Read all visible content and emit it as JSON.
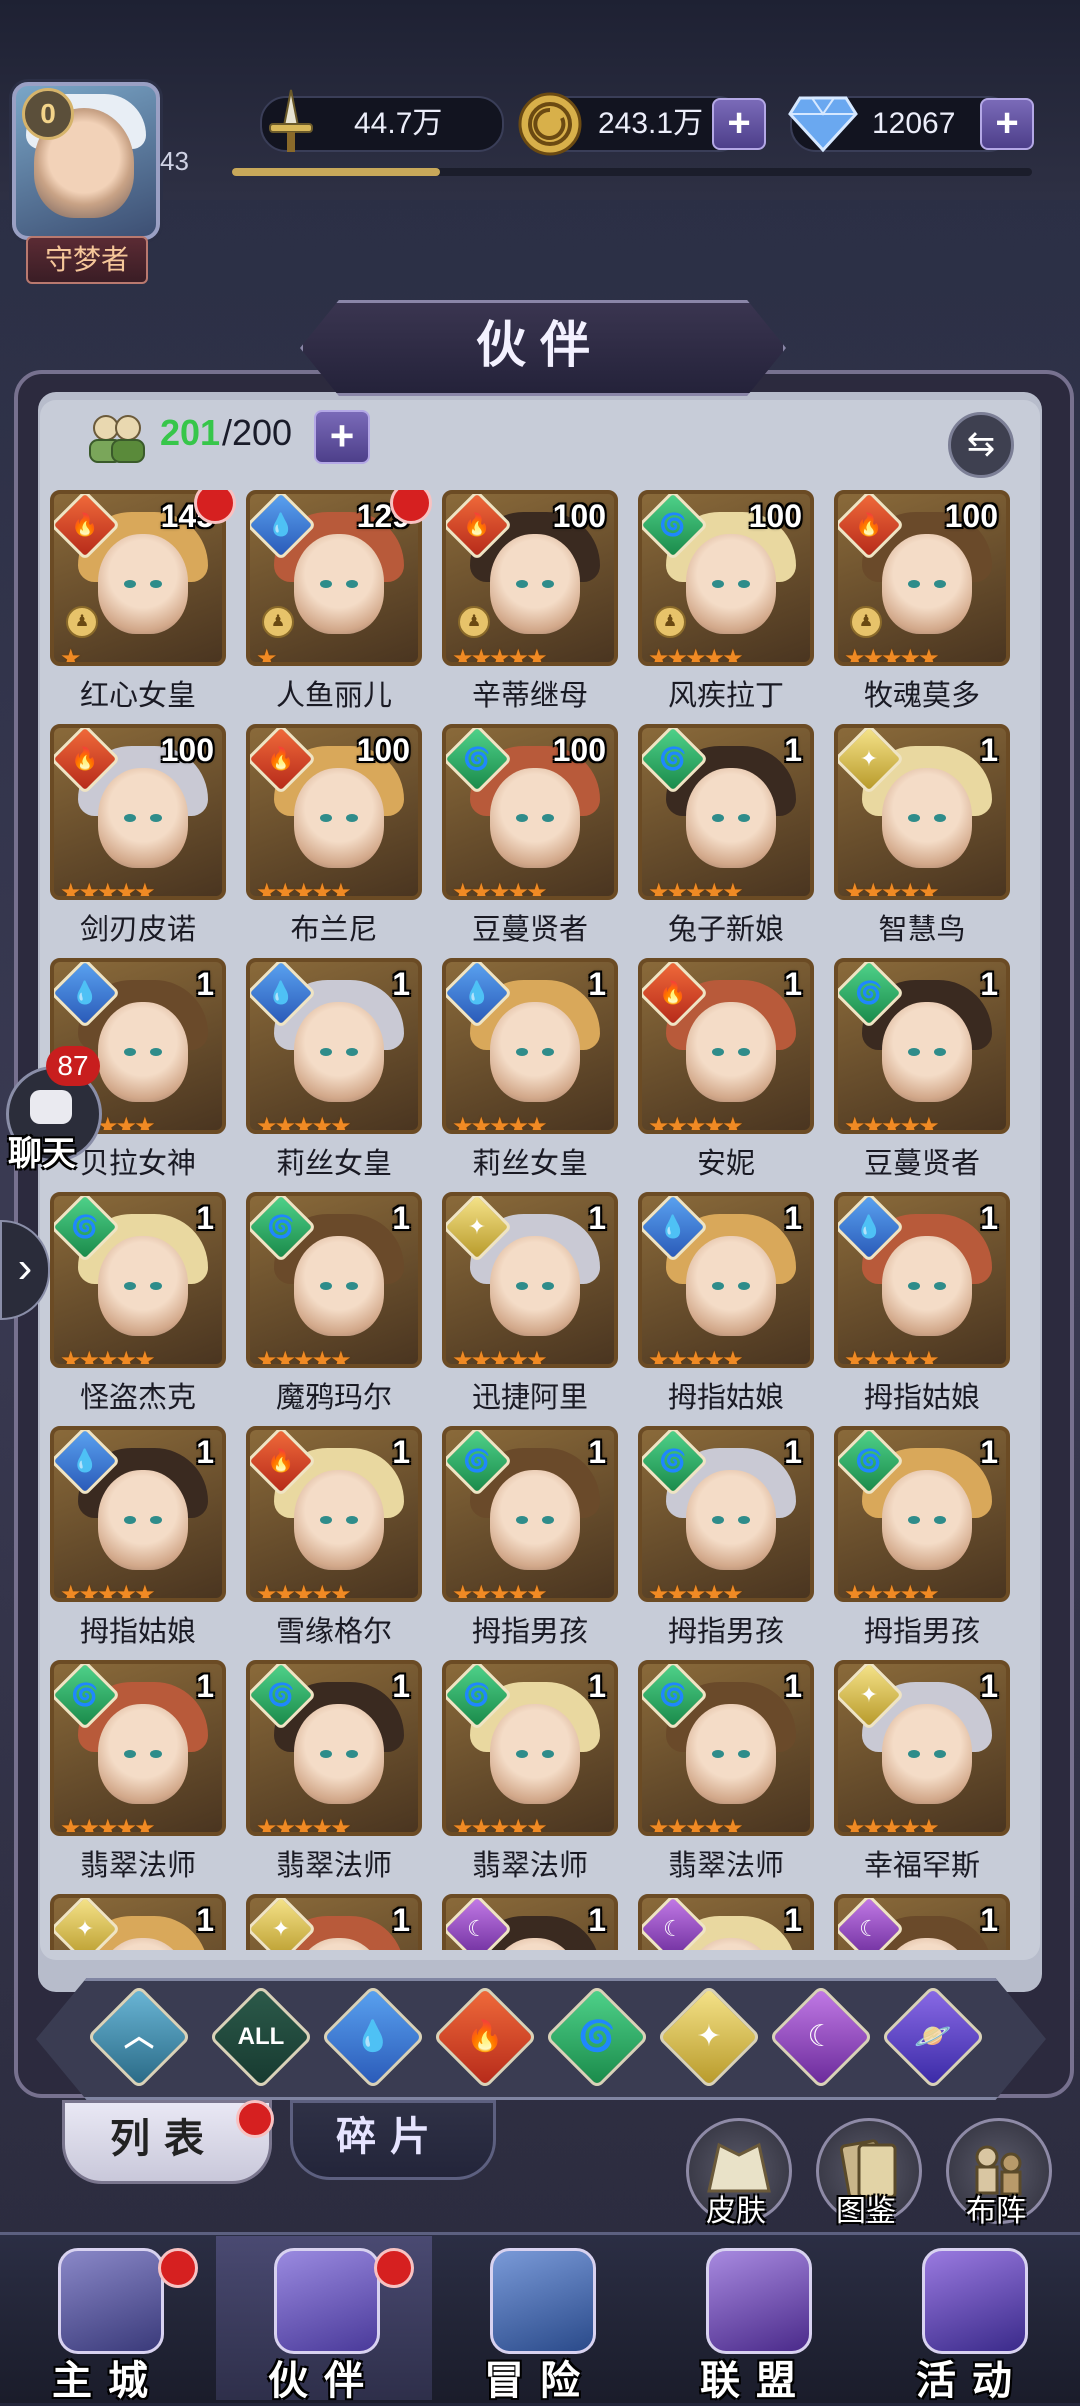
{
  "player": {
    "avatar_level": "0",
    "title": "守梦者",
    "level": "43",
    "exp_fraction": 0.26
  },
  "resources": {
    "power": "44.7万",
    "gold": "243.1万",
    "gems": "12067",
    "plus": "+"
  },
  "page": {
    "title": "伙伴"
  },
  "roster": {
    "current": "201",
    "max": "/200",
    "plus": "+",
    "sort_icon": "⇆"
  },
  "elements": {
    "fire": {
      "glyph": "🔥",
      "color": "#d8452a"
    },
    "water": {
      "glyph": "💧",
      "color": "#3a7ad6"
    },
    "wind": {
      "glyph": "🌀",
      "color": "#2aa864"
    },
    "light": {
      "glyph": "✦",
      "color": "#d4b84a"
    },
    "dark": {
      "glyph": "☾",
      "color": "#9a4ad0"
    }
  },
  "heroes": [
    {
      "name": "红心女皇",
      "level": "145",
      "element": "fire",
      "stars": 1,
      "rank": true,
      "dot": true
    },
    {
      "name": "人鱼丽儿",
      "level": "129",
      "element": "water",
      "stars": 1,
      "rank": true,
      "dot": true
    },
    {
      "name": "辛蒂继母",
      "level": "100",
      "element": "fire",
      "stars": 5,
      "rank": true,
      "dot": false
    },
    {
      "name": "风疾拉丁",
      "level": "100",
      "element": "wind",
      "stars": 5,
      "rank": true,
      "dot": false
    },
    {
      "name": "牧魂莫多",
      "level": "100",
      "element": "fire",
      "stars": 5,
      "rank": true,
      "dot": false
    },
    {
      "name": "剑刃皮诺",
      "level": "100",
      "element": "fire",
      "stars": 5,
      "rank": false,
      "dot": false
    },
    {
      "name": "布兰尼",
      "level": "100",
      "element": "fire",
      "stars": 5,
      "rank": false,
      "dot": false
    },
    {
      "name": "豆蔓贤者",
      "level": "100",
      "element": "wind",
      "stars": 5,
      "rank": false,
      "dot": false
    },
    {
      "name": "兔子新娘",
      "level": "1",
      "element": "wind",
      "stars": 5,
      "rank": false,
      "dot": false
    },
    {
      "name": "智慧鸟",
      "level": "1",
      "element": "light",
      "stars": 5,
      "rank": false,
      "dot": false
    },
    {
      "name": "贝拉女神",
      "level": "1",
      "element": "water",
      "stars": 5,
      "rank": false,
      "dot": false
    },
    {
      "name": "莉丝女皇",
      "level": "1",
      "element": "water",
      "stars": 5,
      "rank": false,
      "dot": false
    },
    {
      "name": "莉丝女皇",
      "level": "1",
      "element": "water",
      "stars": 5,
      "rank": false,
      "dot": false
    },
    {
      "name": "安妮",
      "level": "1",
      "element": "fire",
      "stars": 5,
      "rank": false,
      "dot": false
    },
    {
      "name": "豆蔓贤者",
      "level": "1",
      "element": "wind",
      "stars": 5,
      "rank": false,
      "dot": false
    },
    {
      "name": "怪盗杰克",
      "level": "1",
      "element": "wind",
      "stars": 5,
      "rank": false,
      "dot": false
    },
    {
      "name": "魔鸦玛尔",
      "level": "1",
      "element": "wind",
      "stars": 5,
      "rank": false,
      "dot": false
    },
    {
      "name": "迅捷阿里",
      "level": "1",
      "element": "light",
      "stars": 5,
      "rank": false,
      "dot": false
    },
    {
      "name": "拇指姑娘",
      "level": "1",
      "element": "water",
      "stars": 5,
      "rank": false,
      "dot": false
    },
    {
      "name": "拇指姑娘",
      "level": "1",
      "element": "water",
      "stars": 5,
      "rank": false,
      "dot": false
    },
    {
      "name": "拇指姑娘",
      "level": "1",
      "element": "water",
      "stars": 5,
      "rank": false,
      "dot": false
    },
    {
      "name": "雪缘格尔",
      "level": "1",
      "element": "fire",
      "stars": 5,
      "rank": false,
      "dot": false
    },
    {
      "name": "拇指男孩",
      "level": "1",
      "element": "wind",
      "stars": 5,
      "rank": false,
      "dot": false
    },
    {
      "name": "拇指男孩",
      "level": "1",
      "element": "wind",
      "stars": 5,
      "rank": false,
      "dot": false
    },
    {
      "name": "拇指男孩",
      "level": "1",
      "element": "wind",
      "stars": 5,
      "rank": false,
      "dot": false
    },
    {
      "name": "翡翠法师",
      "level": "1",
      "element": "wind",
      "stars": 5,
      "rank": false,
      "dot": false
    },
    {
      "name": "翡翠法师",
      "level": "1",
      "element": "wind",
      "stars": 5,
      "rank": false,
      "dot": false
    },
    {
      "name": "翡翠法师",
      "level": "1",
      "element": "wind",
      "stars": 5,
      "rank": false,
      "dot": false
    },
    {
      "name": "翡翠法师",
      "level": "1",
      "element": "wind",
      "stars": 5,
      "rank": false,
      "dot": false
    },
    {
      "name": "幸福罕斯",
      "level": "1",
      "element": "light",
      "stars": 5,
      "rank": false,
      "dot": false
    },
    {
      "name": "",
      "level": "1",
      "element": "light",
      "stars": 5,
      "rank": false,
      "dot": false
    },
    {
      "name": "",
      "level": "1",
      "element": "light",
      "stars": 5,
      "rank": false,
      "dot": false
    },
    {
      "name": "",
      "level": "1",
      "element": "dark",
      "stars": 5,
      "rank": false,
      "dot": false
    },
    {
      "name": "",
      "level": "1",
      "element": "dark",
      "stars": 5,
      "rank": false,
      "dot": false
    },
    {
      "name": "",
      "level": "1",
      "element": "dark",
      "stars": 5,
      "rank": false,
      "dot": false
    }
  ],
  "filters": [
    {
      "id": "base",
      "glyph": "︿"
    },
    {
      "id": "all",
      "glyph": "ALL"
    },
    {
      "id": "water",
      "glyph": "💧"
    },
    {
      "id": "fire",
      "glyph": "🔥"
    },
    {
      "id": "wind",
      "glyph": "🌀"
    },
    {
      "id": "light",
      "glyph": "✦"
    },
    {
      "id": "dark",
      "glyph": "☾"
    },
    {
      "id": "cosmic",
      "glyph": "🪐"
    }
  ],
  "tabs": {
    "list": "列表",
    "fragments": "碎片"
  },
  "side_buttons": {
    "skins": "皮肤",
    "codex": "图鉴",
    "formation": "布阵"
  },
  "chat": {
    "count": "87",
    "label": "聊天",
    "arrow": "›"
  },
  "nav": [
    {
      "label": "主城",
      "dot": true
    },
    {
      "label": "伙伴",
      "dot": true
    },
    {
      "label": "冒险",
      "dot": false
    },
    {
      "label": "联盟",
      "dot": false
    },
    {
      "label": "活动",
      "dot": false
    }
  ]
}
